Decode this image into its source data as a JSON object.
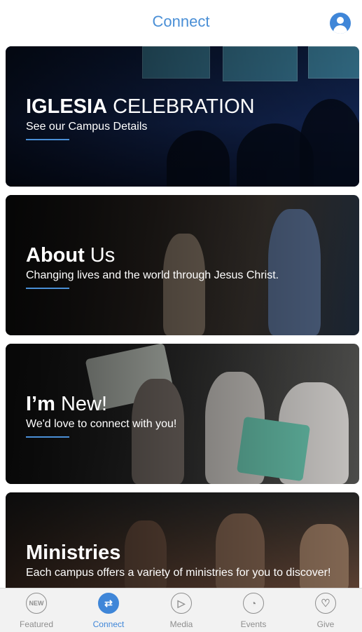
{
  "header": {
    "title": "Connect",
    "profile_icon": "person-circle-icon"
  },
  "cards": [
    {
      "title_bold": "IGLESIA",
      "title_light": " CELEBRATION",
      "subtitle": "See our Campus Details"
    },
    {
      "title_bold": "About",
      "title_light": " Us",
      "subtitle": "Changing lives and the world through Jesus Christ."
    },
    {
      "title_bold": "I’m",
      "title_light": " New!",
      "subtitle": "We'd love to connect with you!"
    },
    {
      "title_bold": "Ministries",
      "title_light": "",
      "subtitle": "Each campus offers a variety of ministries for you to discover!"
    }
  ],
  "tabs": [
    {
      "label": "Featured",
      "icon": "new-badge-icon",
      "glyph": "NEW",
      "active": false
    },
    {
      "label": "Connect",
      "icon": "arrows-exchange-icon",
      "glyph": "⇄",
      "active": true
    },
    {
      "label": "Media",
      "icon": "play-icon",
      "glyph": "▷",
      "active": false
    },
    {
      "label": "Events",
      "icon": "clock-icon",
      "glyph": "◔",
      "active": false
    },
    {
      "label": "Give",
      "icon": "heart-icon",
      "glyph": "♡",
      "active": false
    }
  ],
  "colors": {
    "accent": "#3f86d8",
    "inactive": "#8e8e8e"
  }
}
